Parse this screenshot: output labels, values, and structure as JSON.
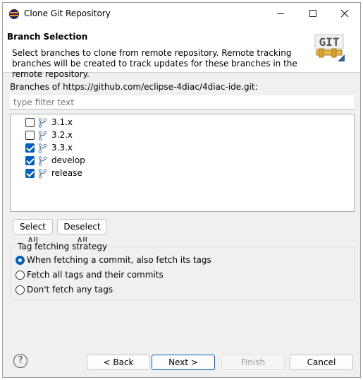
{
  "window": {
    "title": "Clone Git Repository",
    "icon": "eclipse-icon"
  },
  "banner": {
    "title": "Branch Selection",
    "description": "Select branches to clone from remote repository. Remote tracking branches will be created to track updates for these branches in the remote repository.",
    "logo_text": "GIT"
  },
  "branches": {
    "label": "Branches of https://github.com/eclipse-4diac/4diac-ide.git:",
    "filter_placeholder": "type filter text",
    "filter_value": "",
    "items": [
      {
        "name": "3.1.x",
        "checked": false
      },
      {
        "name": "3.2.x",
        "checked": false
      },
      {
        "name": "3.3.x",
        "checked": true
      },
      {
        "name": "develop",
        "checked": true
      },
      {
        "name": "release",
        "checked": true
      }
    ],
    "select_all_label": "Select All",
    "deselect_all_label": "Deselect All"
  },
  "tag_fetching": {
    "legend": "Tag fetching strategy",
    "options": [
      {
        "label": "When fetching a commit, also fetch its tags",
        "selected": true
      },
      {
        "label": "Fetch all tags and their commits",
        "selected": false
      },
      {
        "label": "Don't fetch any tags",
        "selected": false
      }
    ]
  },
  "footer": {
    "help_label": "?",
    "back_label": "< Back",
    "next_label": "Next >",
    "finish_label": "Finish",
    "cancel_label": "Cancel"
  },
  "colors": {
    "accent": "#005fb8",
    "dialog_bg": "#f0f0f0"
  }
}
